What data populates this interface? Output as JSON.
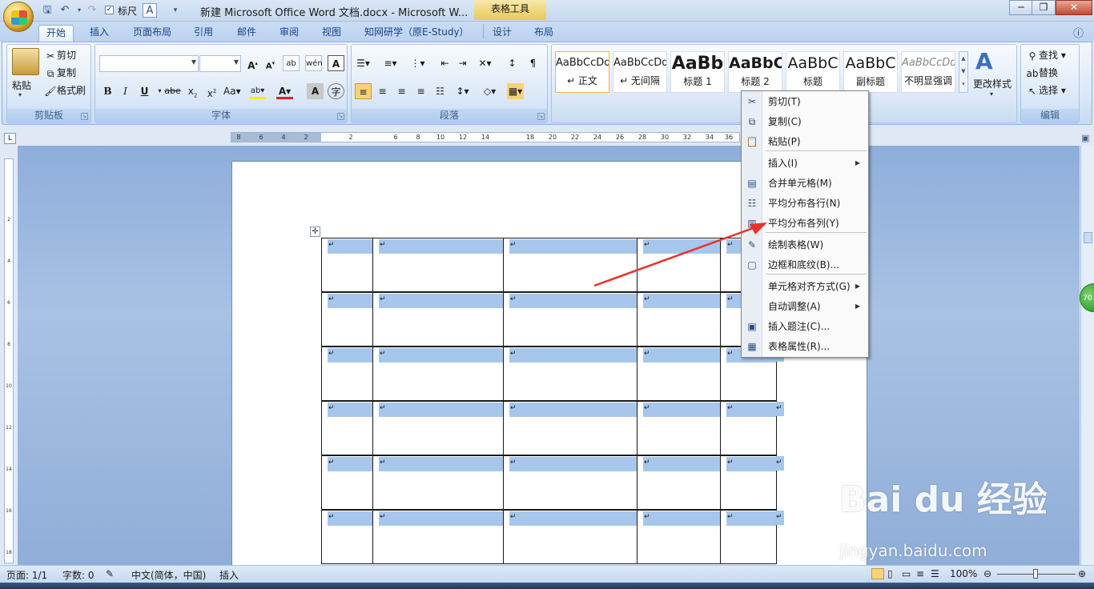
{
  "titlebar": {
    "ruler_label": "标尺",
    "doc_title": "新建 Microsoft Office Word 文档.docx - Microsoft W...",
    "contextual_tab_group": "表格工具",
    "minimize": "─",
    "restore": "❐",
    "close": "✕"
  },
  "tabs": [
    "开始",
    "插入",
    "页面布局",
    "引用",
    "邮件",
    "审阅",
    "视图",
    "知网研学（原E-Study）",
    "设计",
    "布局"
  ],
  "ribbon": {
    "clipboard": {
      "label": "剪贴板",
      "paste": "粘贴",
      "cut": "剪切",
      "copy": "复制",
      "format_painter": "格式刷"
    },
    "font": {
      "label": "字体",
      "font_name": "",
      "font_size": ""
    },
    "paragraph": {
      "label": "段落"
    },
    "styles": {
      "items": [
        {
          "sample": "AaBbCcDd",
          "name": "↵ 正文"
        },
        {
          "sample": "AaBbCcDd",
          "name": "↵ 无间隔"
        },
        {
          "sample": "AaBb",
          "name": "标题 1"
        },
        {
          "sample": "AaBbC",
          "name": "标题 2"
        },
        {
          "sample": "AaBbC",
          "name": "标题"
        },
        {
          "sample": "AaBbC",
          "name": "副标题"
        },
        {
          "sample": "AaBbCcDd",
          "name": "不明显强调"
        }
      ],
      "change_styles": "更改样式"
    },
    "editing": {
      "label": "编辑",
      "find": "查找",
      "replace": "替换",
      "select": "选择"
    }
  },
  "ruler_ticks": [
    "8",
    "6",
    "4",
    "2",
    "2",
    "6",
    "8",
    "10",
    "12",
    "14",
    "18",
    "20",
    "22",
    "24",
    "26",
    "28",
    "30",
    "32",
    "34",
    "36"
  ],
  "table": {
    "rows": 6,
    "col_widths": [
      64,
      163,
      167,
      104,
      70
    ],
    "cell_mark": "↵"
  },
  "context_menu": {
    "items": [
      {
        "label": "剪切(T)",
        "icon": "scissors-icon"
      },
      {
        "label": "复制(C)",
        "icon": "copy-icon"
      },
      {
        "label": "粘贴(P)",
        "icon": "paste-icon"
      },
      {
        "label": "插入(I)",
        "icon": "",
        "submenu": true
      },
      {
        "label": "合并单元格(M)",
        "icon": "merge-cells-icon"
      },
      {
        "label": "平均分布各行(N)",
        "icon": "distribute-rows-icon"
      },
      {
        "label": "平均分布各列(Y)",
        "icon": "distribute-columns-icon"
      },
      {
        "label": "绘制表格(W)",
        "icon": "draw-table-icon"
      },
      {
        "label": "边框和底纹(B)...",
        "icon": "borders-icon"
      },
      {
        "label": "单元格对齐方式(G)",
        "icon": "",
        "submenu": true
      },
      {
        "label": "自动调整(A)",
        "icon": "",
        "submenu": true
      },
      {
        "label": "插入题注(C)...",
        "icon": "caption-icon"
      },
      {
        "label": "表格属性(R)...",
        "icon": "table-properties-icon"
      }
    ]
  },
  "statusbar": {
    "page": "页面: 1/1",
    "words": "字数: 0",
    "language": "中文(简体，中国)",
    "mode": "插入",
    "zoom": "100%"
  },
  "badge": "70",
  "watermark": {
    "logo": "Bai du 经验",
    "url": "jingyan.baidu.com"
  }
}
